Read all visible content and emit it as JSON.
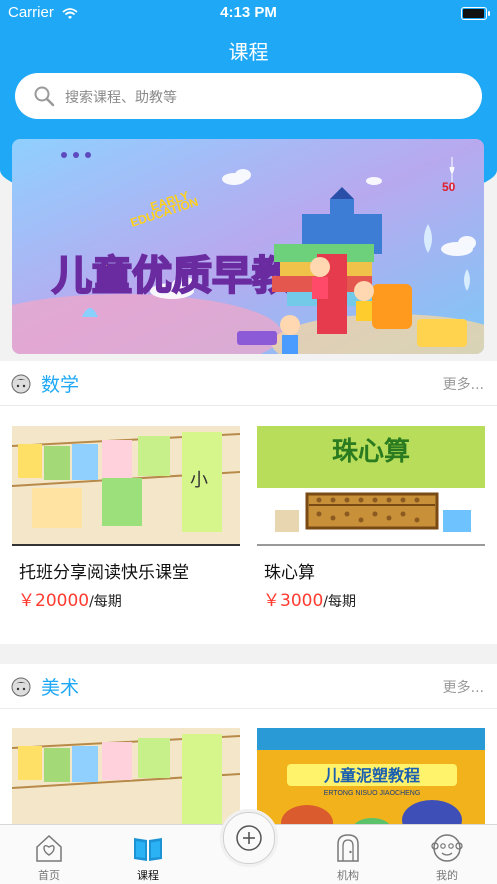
{
  "status_bar": {
    "carrier": "Carrier",
    "time": "4:13 PM"
  },
  "nav": {
    "title": "课程"
  },
  "search": {
    "placeholder": "搜索课程、助教等"
  },
  "banner": {
    "headline_cn": "儿童优质早教",
    "headline_en_1": "EARLY",
    "headline_en_2": "EDUCATION",
    "badge": "50"
  },
  "sections": [
    {
      "title": "数学",
      "more": "更多...",
      "courses": [
        {
          "name": "托班分享阅读快乐课堂",
          "price": "￥20000",
          "period": "/每期"
        },
        {
          "name": "珠心算",
          "price": "￥3000",
          "period": "/每期",
          "image_text": "珠心算"
        }
      ]
    },
    {
      "title": "美术",
      "more": "更多...",
      "courses": [
        {
          "name": "",
          "price": "",
          "period": ""
        },
        {
          "name": "",
          "price": "",
          "period": "",
          "image_text": "儿童泥塑教程",
          "image_subtext": "ERTONG NISUO JIAOCHENG"
        }
      ]
    }
  ],
  "tabbar": {
    "items": [
      {
        "label": "首页",
        "icon": "home-icon"
      },
      {
        "label": "课程",
        "icon": "book-icon",
        "active": true
      },
      {
        "label": "",
        "icon": "plus-icon"
      },
      {
        "label": "机构",
        "icon": "building-icon"
      },
      {
        "label": "我的",
        "icon": "monkey-icon"
      }
    ]
  },
  "colors": {
    "accent": "#1ea8f5",
    "price": "#ff3b30",
    "background": "#f2f2f2"
  }
}
